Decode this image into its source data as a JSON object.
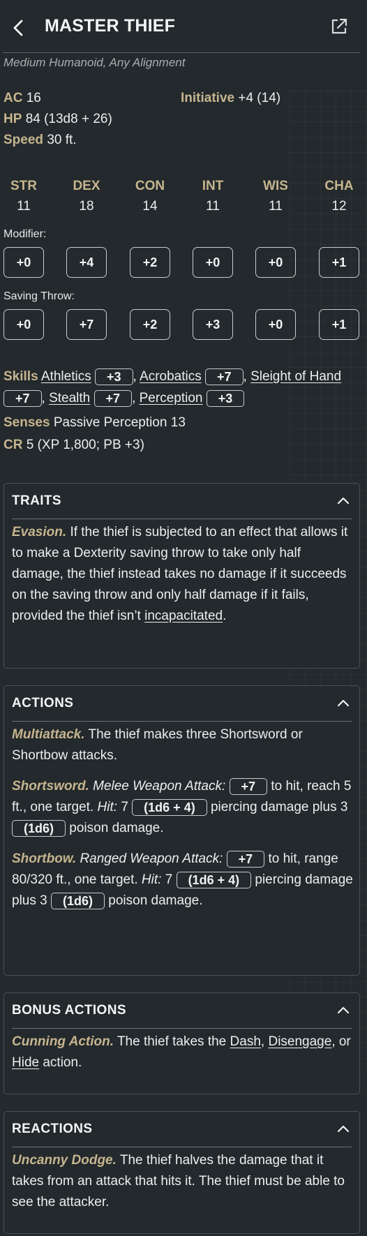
{
  "header": {
    "title": "MASTER THIEF",
    "subtitle": "Medium Humanoid, Any Alignment"
  },
  "stats": {
    "ac_label": "AC",
    "ac_value": "16",
    "hp_label": "HP",
    "hp_value": "84 (13d8 + 26)",
    "speed_label": "Speed",
    "speed_value": "30 ft.",
    "init_label": "Initiative",
    "init_value": "+4 (14)"
  },
  "abilities": [
    {
      "name": "STR",
      "score": "11",
      "mod": "+0",
      "save": "+0"
    },
    {
      "name": "DEX",
      "score": "18",
      "mod": "+4",
      "save": "+7"
    },
    {
      "name": "CON",
      "score": "14",
      "mod": "+2",
      "save": "+2"
    },
    {
      "name": "INT",
      "score": "11",
      "mod": "+0",
      "save": "+3"
    },
    {
      "name": "WIS",
      "score": "11",
      "mod": "+0",
      "save": "+0"
    },
    {
      "name": "CHA",
      "score": "12",
      "mod": "+1",
      "save": "+1"
    }
  ],
  "labels": {
    "modifier": "Modifier:",
    "saving_throw": "Saving Throw:"
  },
  "skills": {
    "label": "Skills",
    "items": [
      {
        "name": "Athletics",
        "bonus": "+3"
      },
      {
        "name": "Acrobatics",
        "bonus": "+7"
      },
      {
        "name": "Sleight of Hand",
        "bonus": "+7"
      },
      {
        "name": "Stealth",
        "bonus": "+7"
      },
      {
        "name": "Perception",
        "bonus": "+3"
      }
    ]
  },
  "senses": {
    "label": "Senses",
    "value": "Passive Perception 13"
  },
  "cr": {
    "label": "CR",
    "value": "5 (XP 1,800; PB +3)"
  },
  "traits": {
    "title": "TRAITS",
    "evasion_name": "Evasion.",
    "evasion_text": "If the thief is subjected to an effect that allows it to make a Dexterity saving throw to take only half damage, the thief instead takes no damage if it succeeds on the saving throw and only half damage if it fails, provided the thief isn’t",
    "evasion_link": "incapacitated",
    "evasion_end": "."
  },
  "actions": {
    "title": "ACTIONS",
    "multi_name": "Multiattack.",
    "multi_text": "The thief makes three Shortsword or Shortbow attacks.",
    "sword_name": "Shortsword.",
    "sword_type": "Melee Weapon Attack:",
    "sword_hit": "+7",
    "to_hit": "to hit,",
    "sword_reach": "reach 5 ft., one target.",
    "hit_label": "Hit:",
    "sword_dmg": "7",
    "sword_dice": "(1d6 + 4)",
    "piercing": "piercing damage plus 3",
    "poison_dice": "(1d6)",
    "poison": "poison damage.",
    "bow_name": "Shortbow.",
    "bow_type": "Ranged Weapon Attack:",
    "bow_hit": "+7",
    "bow_range": "range 80/320 ft., one target.",
    "bow_dmg": "7",
    "bow_dice": "(1d6 + 4)"
  },
  "bonus_actions": {
    "title": "BONUS ACTIONS",
    "name": "Cunning Action.",
    "text": "The thief takes the",
    "dash": "Dash",
    "disengage": "Disengage",
    "or": ", or",
    "hide": "Hide",
    "end": "action."
  },
  "reactions": {
    "title": "REACTIONS",
    "name": "Uncanny Dodge.",
    "text": "The thief halves the damage that it takes from an attack that hits it. The thief must be able to see the attacker."
  },
  "icons": {
    "back": "chevron-left-icon",
    "external": "external-link-icon",
    "collapse": "chevron-up-icon"
  },
  "colors": {
    "background": "#23292c",
    "accent": "#c6b58f",
    "text": "#eceeee"
  }
}
